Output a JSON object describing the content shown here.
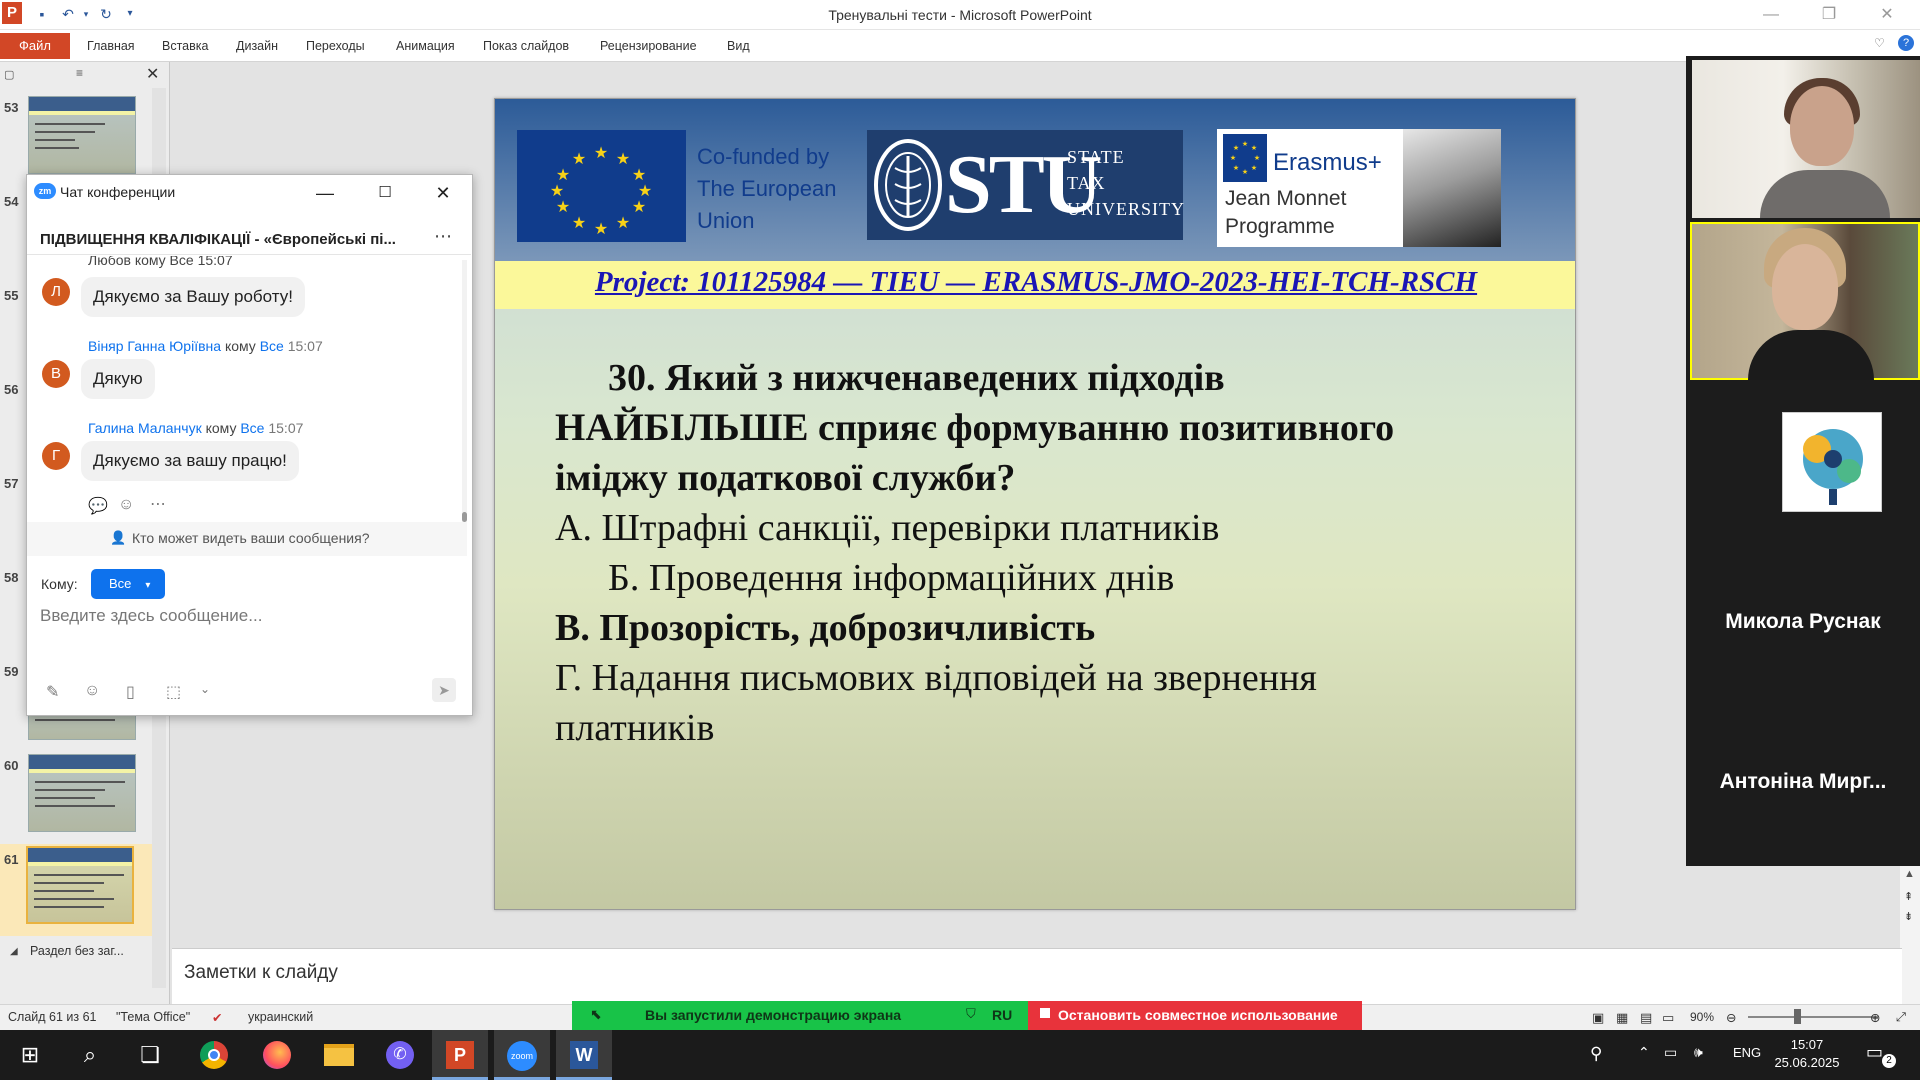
{
  "window": {
    "title": "Тренувальні тести  -  Microsoft PowerPoint",
    "app_letter": "P"
  },
  "ribbon": {
    "file_tab": "Файл",
    "tabs": [
      "Главная",
      "Вставка",
      "Дизайн",
      "Переходы",
      "Анимация",
      "Показ слайдов",
      "Рецензирование",
      "Вид"
    ]
  },
  "thumbnails": {
    "numbers": [
      "53",
      "54",
      "55",
      "56",
      "57",
      "58",
      "59",
      "60",
      "61"
    ],
    "section_label": "Раздел без заг..."
  },
  "slide": {
    "cofunded": [
      "Co-funded by",
      "The European",
      "Union"
    ],
    "stu_big": "STU",
    "stu_small": [
      "STATE",
      "TAX",
      "UNIVERSITY"
    ],
    "erasmus_label": "Erasmus+",
    "jean_monnet": [
      "Jean Monnet",
      "Programme"
    ],
    "project": "Project: 101125984 — TIEU — ERASMUS-JMO-2023-HEI-TCH-RSCH",
    "question_line1": "30. Який з нижченаведених підходів",
    "question_line2_bold": "НАЙБІЛЬШЕ",
    "question_line2_rest": " сприяє формуванню позитивного",
    "question_line3": "іміджу податкової служби?",
    "options": [
      "А. Штрафні санкції, перевірки платників",
      "Б. Проведення інформаційних днів",
      "В. Прозорість, доброзичливість",
      "Г. Надання письмових відповідей на звернення",
      "платників"
    ]
  },
  "notes": {
    "placeholder": "Заметки к слайду"
  },
  "status": {
    "slide_counter": "Слайд 61 из 61",
    "theme": "\"Тема Office\"",
    "language": "украинский",
    "zoom": "90%"
  },
  "zoom_share": {
    "sharing_text": "Вы запустили демонстрацию экрана",
    "lang": "RU",
    "stop_text": "Остановить совместное использование"
  },
  "chat": {
    "title": "Чат конференции",
    "conference_name": "ПІДВИЩЕННЯ КВАЛІФІКАЦІЇ - «Європейські пі...",
    "cut_sender": "Любов  кому Все  15:07",
    "messages": [
      {
        "initial": "Л",
        "sender": "",
        "to": "",
        "time": "",
        "text": "Дякуємо за  Вашу роботу!"
      },
      {
        "initial": "В",
        "sender": "Віняр Ганна Юріївна",
        "to": "Все",
        "time": "15:07",
        "text": "Дякую"
      },
      {
        "initial": "Г",
        "sender": "Галина Маланчук",
        "to": "Все",
        "time": "15:07",
        "text": "Дякуємо за вашу працю!"
      }
    ],
    "to_word": "кому",
    "who_can_see": "Кто может видеть ваши сообщения?",
    "to_label": "Кому:",
    "to_value": "Все",
    "input_placeholder": "Введите здесь сообщение..."
  },
  "video": {
    "participants": [
      "Микола Руснак",
      "Антоніна Мирг..."
    ]
  },
  "taskbar": {
    "lang": "ENG",
    "time": "15:07",
    "date": "25.06.2025",
    "notifications": "2"
  }
}
